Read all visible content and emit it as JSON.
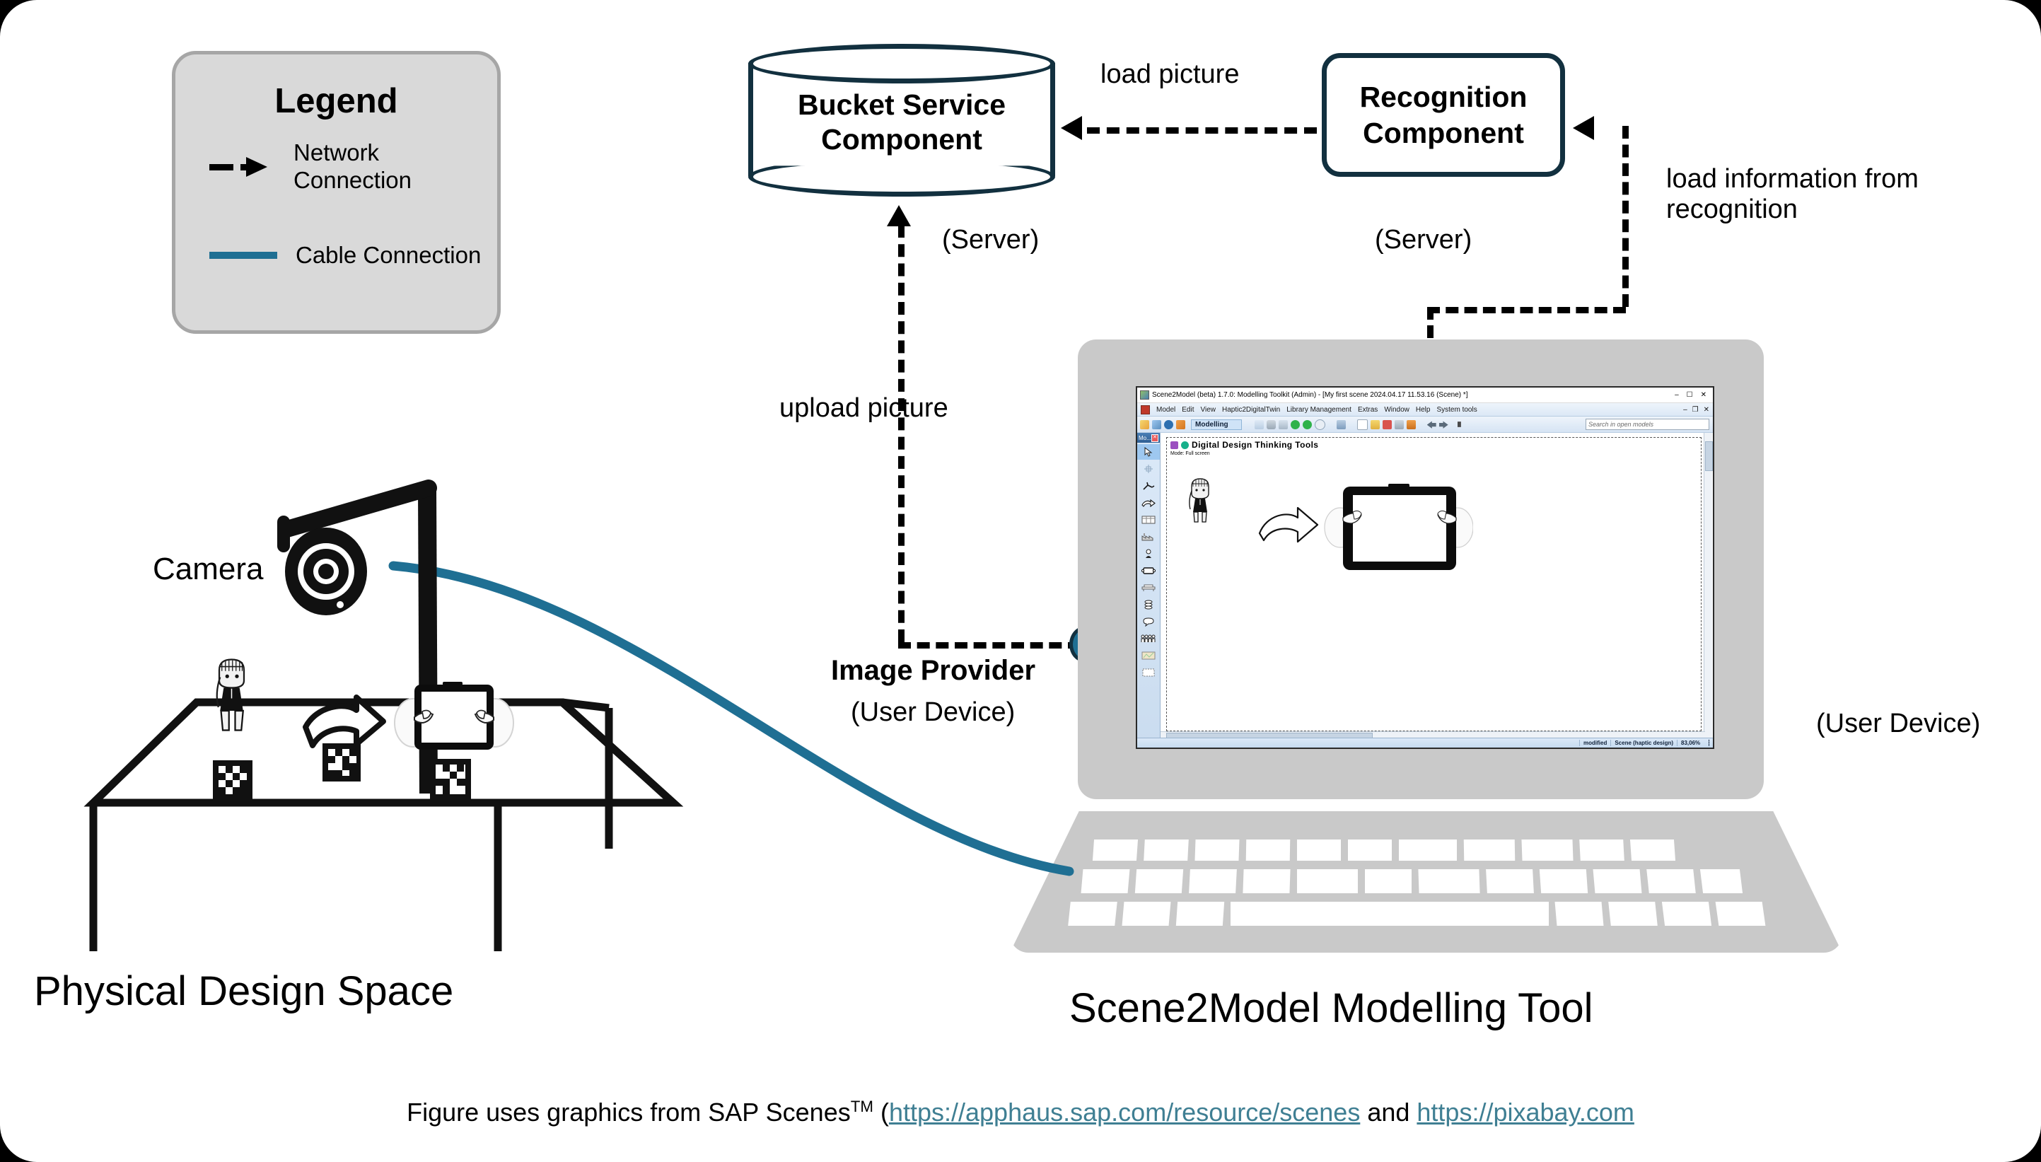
{
  "legend": {
    "title": "Legend",
    "items": [
      {
        "icon": "dashed-arrow-icon",
        "label": "Network\nConnection"
      },
      {
        "icon": "solid-line-icon",
        "label": "Cable\nConnection"
      }
    ],
    "accent_color": "#1f6f93",
    "panel_bg": "#d9d9d9"
  },
  "diagram": {
    "nodes": {
      "bucket": {
        "name": "Bucket Service\nComponent",
        "sublabel": "(Server)",
        "shape": "cylinder",
        "stroke": "#12303f"
      },
      "recognition": {
        "name": "Recognition\nComponent",
        "sublabel": "(Server)",
        "shape": "rounded-rect",
        "stroke": "#12303f"
      },
      "image_provider": {
        "name": "Image Provider",
        "sublabel": "(User Device)"
      },
      "laptop": {
        "sublabel": "(User\nDevice)"
      }
    },
    "edges": [
      {
        "label": "load picture",
        "from": "recognition",
        "to": "bucket",
        "style": "dashed"
      },
      {
        "label": "load information\nfrom recognition",
        "from": "laptop",
        "to": "recognition",
        "style": "dashed"
      },
      {
        "label": "upload\npicture",
        "from": "image_provider",
        "to": "bucket",
        "style": "dashed"
      }
    ],
    "camera_label": "Camera"
  },
  "captions": {
    "left": "Physical Design Space",
    "right": "Scene2Model Modelling Tool"
  },
  "app": {
    "title": "Scene2Model (beta) 1.7.0: Modelling Toolkit (Admin) - [My first scene 2024.04.17 11.53.16 (Scene) *]",
    "window_buttons": [
      "–",
      "☐",
      "✕"
    ],
    "menu": [
      "Model",
      "Edit",
      "View",
      "Haptic2DigitalTwin",
      "Library Management",
      "Extras",
      "Window",
      "Help",
      "System tools"
    ],
    "menu_right": [
      "–",
      "❐",
      "✕"
    ],
    "mode_chip": "Modelling",
    "search_placeholder": "Search in open models",
    "stencil_header": "Mo...",
    "canvas_title": "Digital Design Thinking Tools",
    "canvas_mode": "Mode: Full screen",
    "status": [
      "modified",
      "Scene (haptic design)",
      "83,06%"
    ]
  },
  "footer": {
    "prefix": "Figure uses graphics from SAP Scenes",
    "tm": "TM",
    "open_paren": " (",
    "link1": "https://apphaus.sap.com/resource/scenes",
    "middle": " and ",
    "link2": "https://pixabay.com"
  }
}
